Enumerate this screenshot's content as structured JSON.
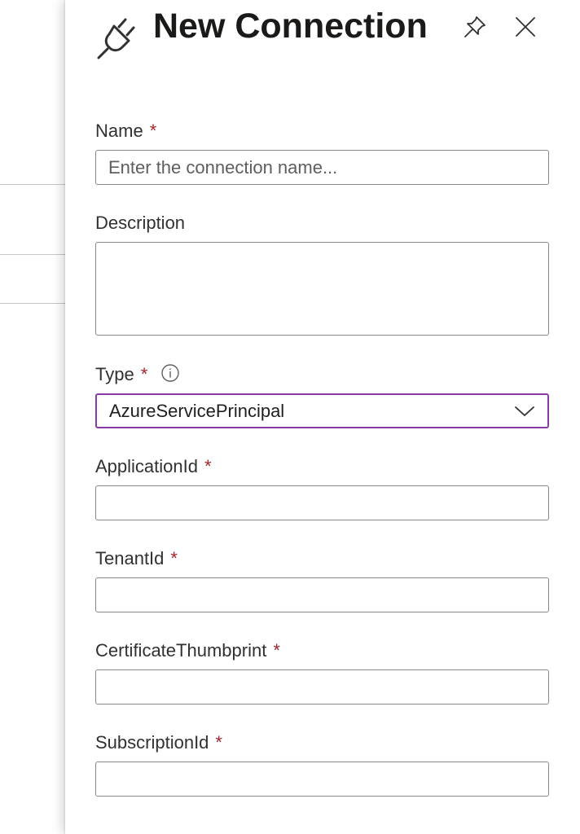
{
  "panel": {
    "title": "New Connection",
    "icons": {
      "title_icon": "plug-icon",
      "pin": "pin-icon",
      "close": "close-icon"
    }
  },
  "form": {
    "required_marker": "*",
    "required_color": "#a4262c",
    "focus_color": "#8a3aa5",
    "name": {
      "label": "Name",
      "placeholder": "Enter the connection name...",
      "value": ""
    },
    "description": {
      "label": "Description",
      "value": ""
    },
    "type": {
      "label": "Type",
      "info_icon": "info-icon",
      "selected": "AzureServicePrincipal",
      "chevron": "chevron-down-icon"
    },
    "application_id": {
      "label": "ApplicationId",
      "value": ""
    },
    "tenant_id": {
      "label": "TenantId",
      "value": ""
    },
    "certificate_thumbprint": {
      "label": "CertificateThumbprint",
      "value": ""
    },
    "subscription_id": {
      "label": "SubscriptionId",
      "value": ""
    }
  }
}
